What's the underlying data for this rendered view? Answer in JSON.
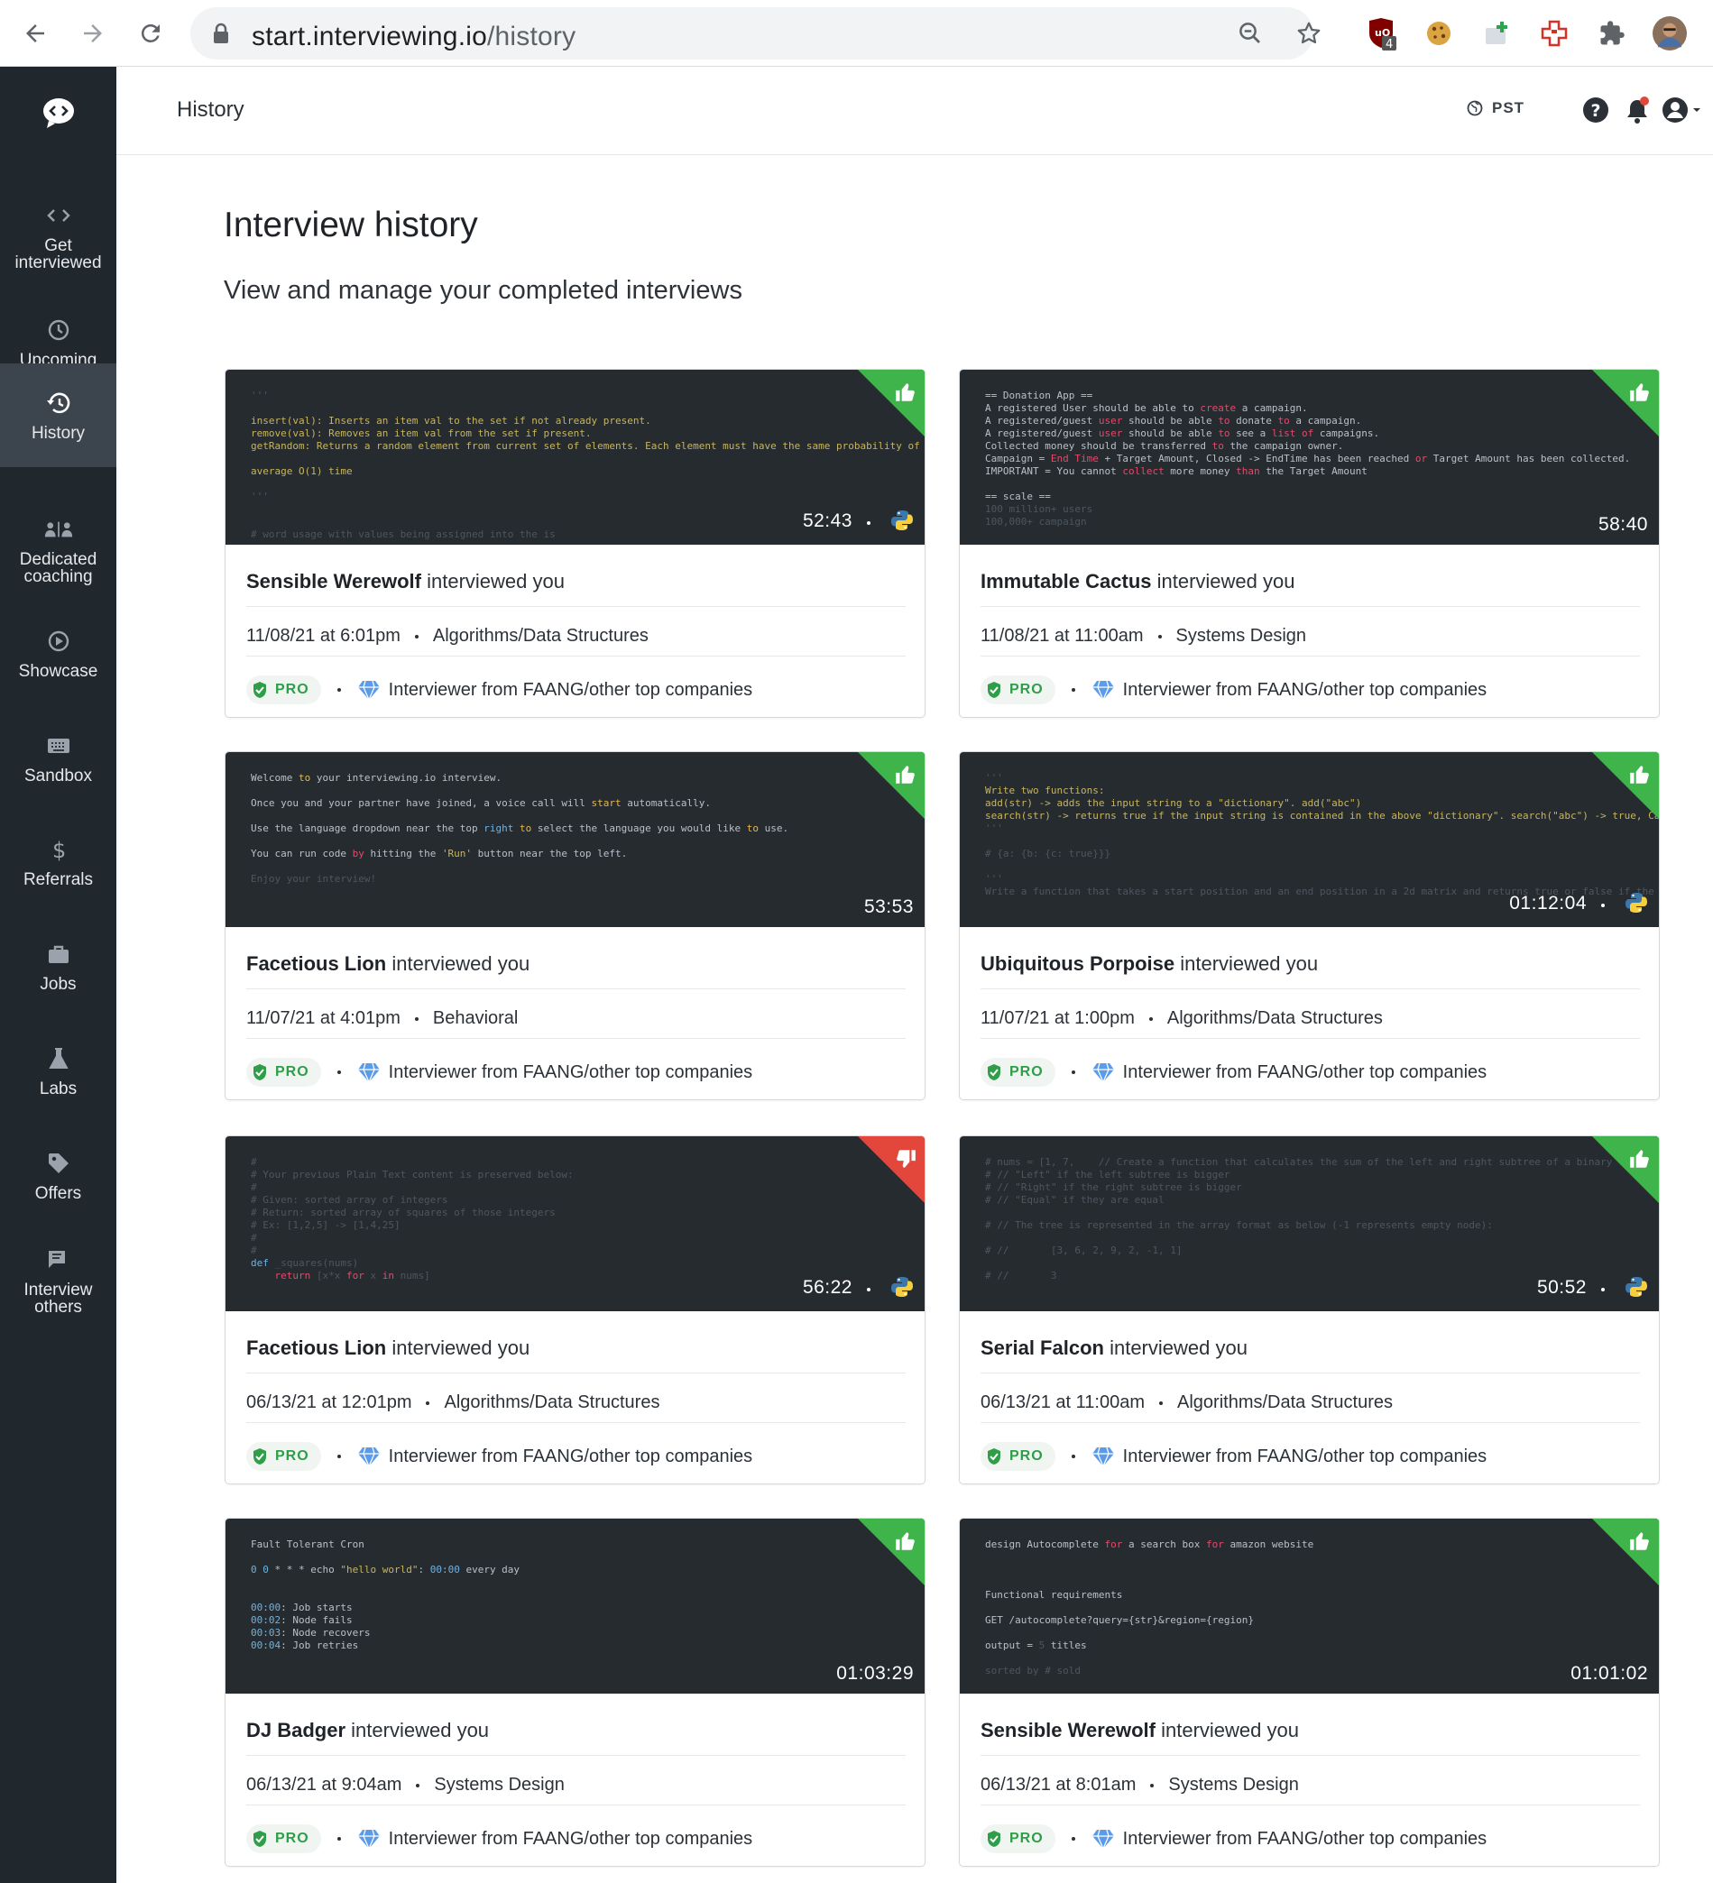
{
  "browser": {
    "url_host": "start.interviewing.io",
    "url_path": "/history",
    "extension_badge": "4"
  },
  "sidebar": {
    "items": [
      {
        "label_line1": "Get",
        "label_line2": "interviewed",
        "icon": "code-brackets-icon"
      },
      {
        "label_line1": "Upcoming",
        "label_line2": "",
        "icon": "clock-icon"
      },
      {
        "label_line1": "History",
        "label_line2": "",
        "icon": "history-icon",
        "active": true
      },
      {
        "label_line1": "Dedicated",
        "label_line2": "coaching",
        "icon": "coaching-icon"
      },
      {
        "label_line1": "Showcase",
        "label_line2": "",
        "icon": "play-circle-icon"
      },
      {
        "label_line1": "Sandbox",
        "label_line2": "",
        "icon": "keyboard-icon"
      },
      {
        "label_line1": "Referrals",
        "label_line2": "",
        "icon": "dollar-icon"
      },
      {
        "label_line1": "Jobs",
        "label_line2": "",
        "icon": "briefcase-icon"
      },
      {
        "label_line1": "Labs",
        "label_line2": "",
        "icon": "flask-icon"
      },
      {
        "label_line1": "Offers",
        "label_line2": "",
        "icon": "tag-icon"
      },
      {
        "label_line1": "Interview",
        "label_line2": "others",
        "icon": "chat-icon"
      }
    ]
  },
  "header": {
    "breadcrumb": "History",
    "timezone": "PST"
  },
  "main": {
    "title": "Interview history",
    "subtitle": "View and manage your completed interviews",
    "cards": [
      {
        "interviewer": "Sensible Werewolf",
        "suffix": "interviewed you",
        "date": "11/08/21 at 6:01pm",
        "type": "Algorithms/Data Structures",
        "badge": "PRO",
        "note": "Interviewer from FAANG/other top companies",
        "duration": "52:43",
        "rating": "thumbs-up",
        "language": "python"
      },
      {
        "interviewer": "Immutable Cactus",
        "suffix": "interviewed you",
        "date": "11/08/21 at 11:00am",
        "type": "Systems Design",
        "badge": "PRO",
        "note": "Interviewer from FAANG/other top companies",
        "duration": "58:40",
        "rating": "thumbs-up",
        "language": ""
      },
      {
        "interviewer": "Facetious Lion",
        "suffix": "interviewed you",
        "date": "11/07/21 at 4:01pm",
        "type": "Behavioral",
        "badge": "PRO",
        "note": "Interviewer from FAANG/other top companies",
        "duration": "53:53",
        "rating": "thumbs-up",
        "language": ""
      },
      {
        "interviewer": "Ubiquitous Porpoise",
        "suffix": "interviewed you",
        "date": "11/07/21 at 1:00pm",
        "type": "Algorithms/Data Structures",
        "badge": "PRO",
        "note": "Interviewer from FAANG/other top companies",
        "duration": "01:12:04",
        "rating": "thumbs-up",
        "language": "python"
      },
      {
        "interviewer": "Facetious Lion",
        "suffix": "interviewed you",
        "date": "06/13/21 at 12:01pm",
        "type": "Algorithms/Data Structures",
        "badge": "PRO",
        "note": "Interviewer from FAANG/other top companies",
        "duration": "56:22",
        "rating": "thumbs-down",
        "language": "python"
      },
      {
        "interviewer": "Serial Falcon",
        "suffix": "interviewed you",
        "date": "06/13/21 at 11:00am",
        "type": "Algorithms/Data Structures",
        "badge": "PRO",
        "note": "Interviewer from FAANG/other top companies",
        "duration": "50:52",
        "rating": "thumbs-up",
        "language": "python"
      },
      {
        "interviewer": "DJ Badger",
        "suffix": "interviewed you",
        "date": "06/13/21 at 9:04am",
        "type": "Systems Design",
        "badge": "PRO",
        "note": "Interviewer from FAANG/other top companies",
        "duration": "01:03:29",
        "rating": "thumbs-up",
        "language": ""
      },
      {
        "interviewer": "Sensible Werewolf",
        "suffix": "interviewed you",
        "date": "06/13/21 at 8:01am",
        "type": "Systems Design",
        "badge": "PRO",
        "note": "Interviewer from FAANG/other top companies",
        "duration": "01:01:02",
        "rating": "thumbs-up",
        "language": ""
      }
    ]
  },
  "colors": {
    "sidebar_bg": "#20282e",
    "sidebar_active": "#3c454d",
    "thumb_bg": "#262b30",
    "thumbs_up": "#3fb44a",
    "thumbs_down": "#e3473b",
    "pro_green": "#2e9e49",
    "gem_blue": "#3d7fdc"
  }
}
